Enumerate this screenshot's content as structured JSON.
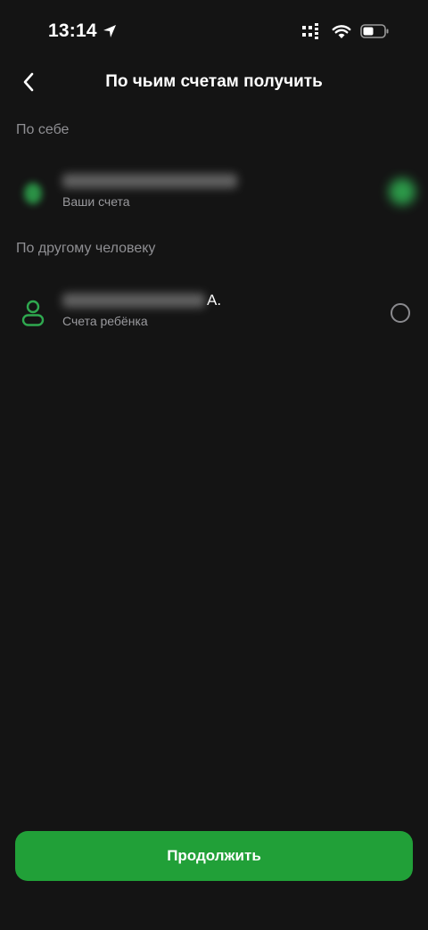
{
  "status_bar": {
    "time": "13:14",
    "icons": [
      "location-arrow-icon",
      "cellular-icon",
      "wifi-icon",
      "battery-icon"
    ]
  },
  "header": {
    "title": "По чьим счетам получить",
    "back_icon": "chevron-left-icon"
  },
  "sections": {
    "self": {
      "label": "По себе",
      "item": {
        "subtitle": "Ваши счета",
        "selected": true
      }
    },
    "other": {
      "label": "По другому человеку",
      "item": {
        "name_suffix": "А.",
        "subtitle": "Счета ребёнка",
        "icon": "person-icon",
        "selected": false
      }
    }
  },
  "footer": {
    "continue_label": "Продолжить"
  },
  "colors": {
    "background": "#141414",
    "accent": "#21a038",
    "icon_green": "#2fa84f",
    "secondary_text": "#8f8f93"
  }
}
